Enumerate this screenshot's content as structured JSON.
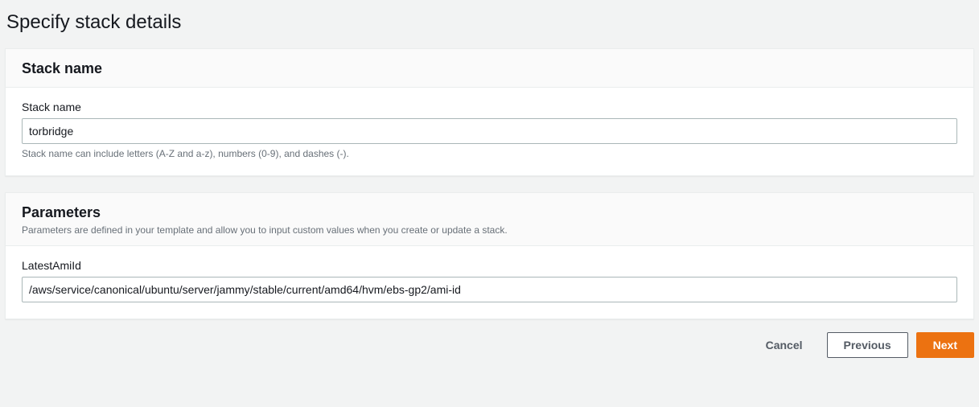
{
  "page": {
    "title": "Specify stack details"
  },
  "stackName": {
    "sectionTitle": "Stack name",
    "fieldLabel": "Stack name",
    "value": "torbridge",
    "hint": "Stack name can include letters (A-Z and a-z), numbers (0-9), and dashes (-)."
  },
  "parameters": {
    "sectionTitle": "Parameters",
    "sectionDesc": "Parameters are defined in your template and allow you to input custom values when you create or update a stack.",
    "items": [
      {
        "label": "LatestAmiId",
        "value": "/aws/service/canonical/ubuntu/server/jammy/stable/current/amd64/hvm/ebs-gp2/ami-id"
      }
    ]
  },
  "actions": {
    "cancel": "Cancel",
    "previous": "Previous",
    "next": "Next"
  }
}
